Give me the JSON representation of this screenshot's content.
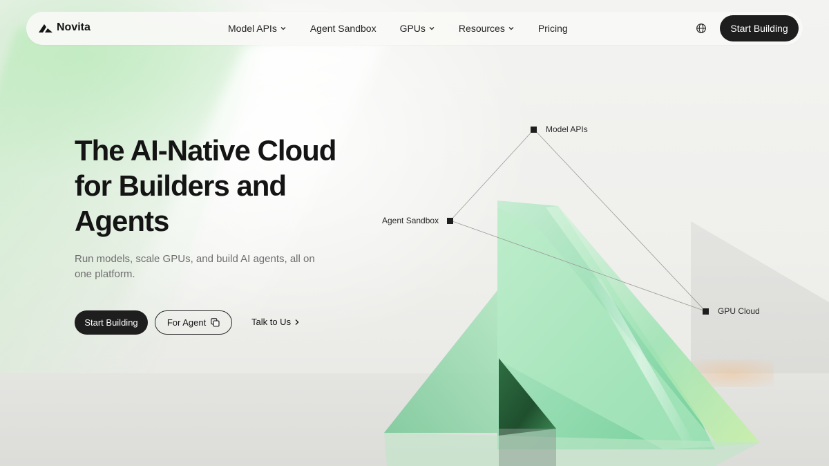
{
  "brand": {
    "name": "Novita"
  },
  "nav": {
    "items": [
      {
        "label": "Model APIs",
        "has_dropdown": true
      },
      {
        "label": "Agent Sandbox",
        "has_dropdown": false
      },
      {
        "label": "GPUs",
        "has_dropdown": true
      },
      {
        "label": "Resources",
        "has_dropdown": true
      },
      {
        "label": "Pricing",
        "has_dropdown": false
      }
    ],
    "language_icon": "globe-icon",
    "cta_label": "Start Building"
  },
  "hero": {
    "title_lines": [
      "The AI-Native Cloud",
      "for Builders and",
      "Agents"
    ],
    "subtitle": "Run models, scale GPUs, and build AI agents, all on one platform.",
    "primary_cta": "Start Building",
    "secondary_cta": "For Agent",
    "secondary_cta_icon": "copy-icon",
    "link_cta": "Talk to Us"
  },
  "diagram": {
    "nodes": [
      {
        "id": "model-apis",
        "label": "Model APIs"
      },
      {
        "id": "agent-sandbox",
        "label": "Agent Sandbox"
      },
      {
        "id": "gpu-cloud",
        "label": "GPU Cloud"
      }
    ]
  },
  "colors": {
    "dark": "#1e1e1e",
    "accent_green": "#8fdca6",
    "background": "#efefed"
  }
}
